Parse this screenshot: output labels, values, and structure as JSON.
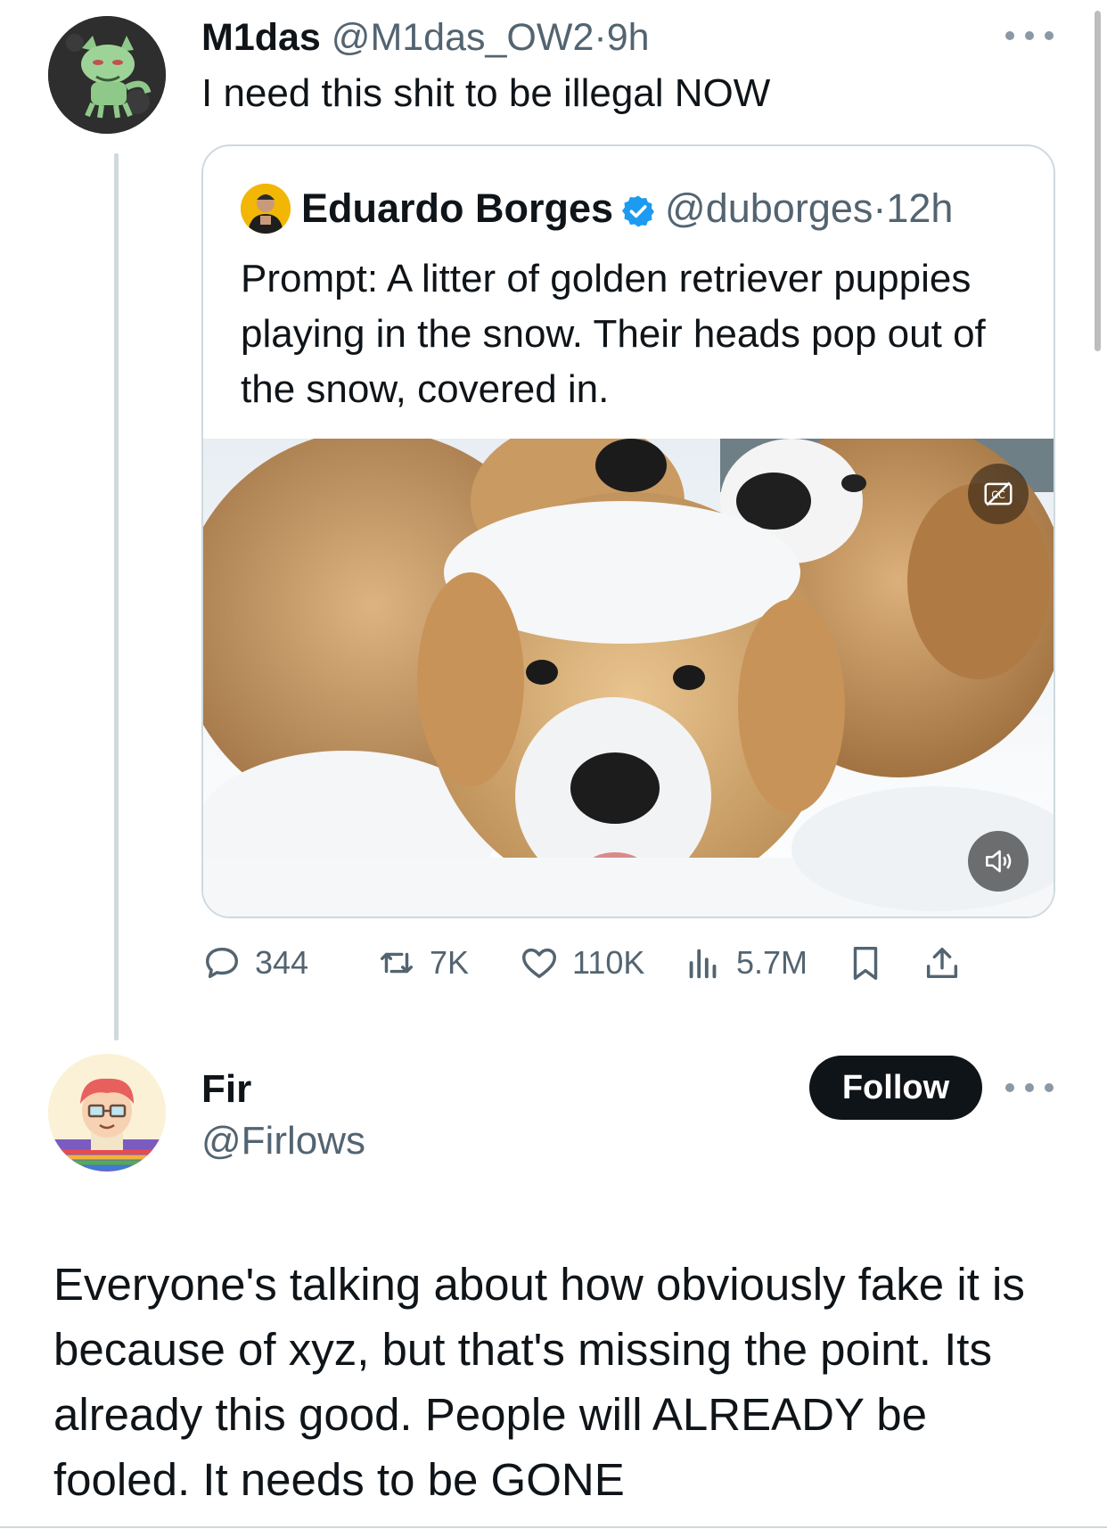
{
  "tweet": {
    "author_name": "M1das",
    "author_handle": "@M1das_OW2",
    "time": "9h",
    "text": "I need this shit to be illegal NOW",
    "avatar_icon": "green-cat-avatar"
  },
  "quote": {
    "author_name": "Eduardo Borges",
    "author_handle": "@duborges",
    "time": "12h",
    "verified_icon": "verified-badge-icon",
    "text": "Prompt: A litter of golden retriever puppies playing in the snow. Their heads pop out of the snow, covered in.",
    "media_description_icon": "video-thumbnail",
    "cc_icon": "captions-off-icon",
    "volume_icon": "speaker-icon"
  },
  "actions": {
    "replies": "344",
    "reposts": "7K",
    "likes": "110K",
    "views": "5.7M"
  },
  "reply": {
    "author_name": "Fir",
    "author_handle": "@Firlows",
    "follow_label": "Follow",
    "text": "Everyone's talking about how obviously fake it is because of xyz, but that's missing the point. Its already this good. People will ALREADY be fooled. It needs to be GONE"
  },
  "separator": "·",
  "colors": {
    "text": "#0f1419",
    "muted": "#536471",
    "verified": "#1d9bf0",
    "border": "#cfd9de"
  }
}
